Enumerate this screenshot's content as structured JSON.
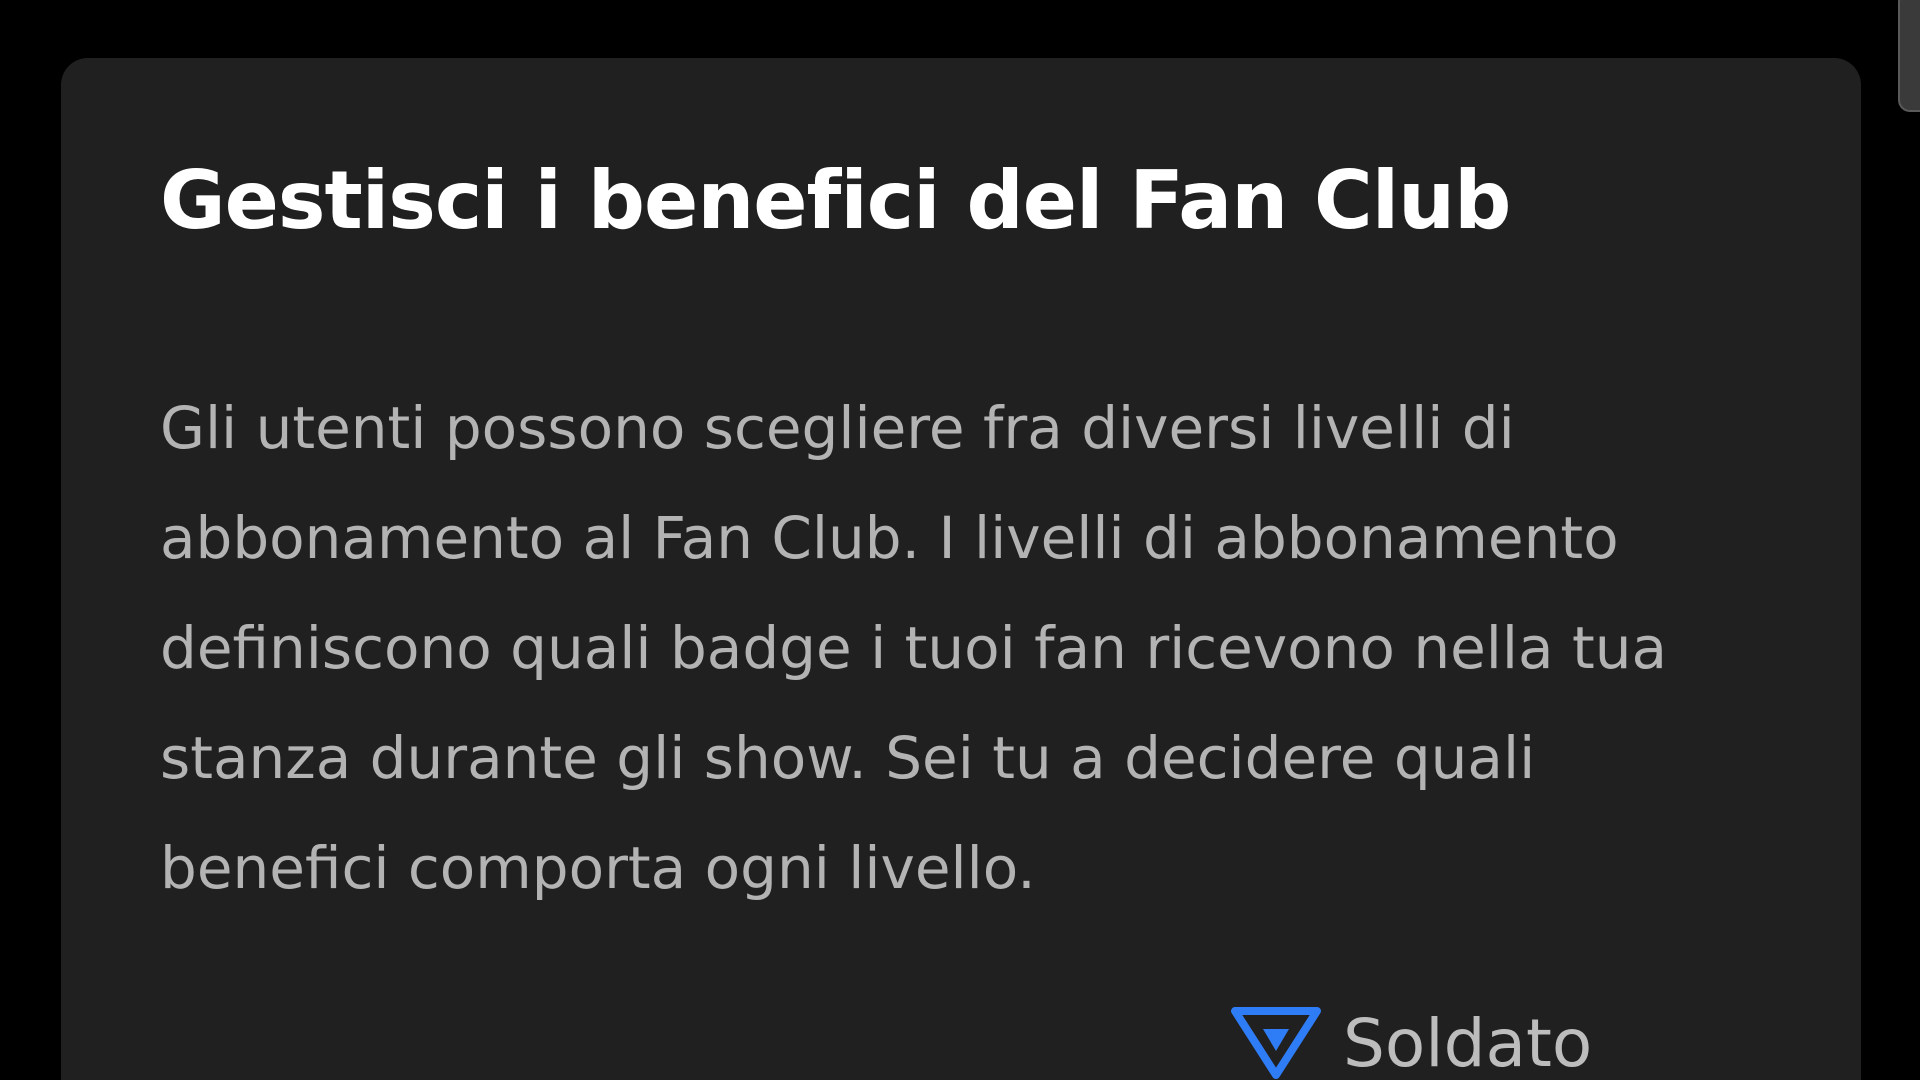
{
  "card": {
    "title": "Gestisci i benefici del Fan Club",
    "description": "Gli utenti possono scegliere fra diversi livelli di abbonamento al Fan Club. I livelli di abbonamento definiscono quali badge i tuoi fan ricevono nella tua stanza durante gli show. Sei tu a decidere quali benefici comporta ogni livello.",
    "tier": {
      "icon": "inverted-triangle-badge-icon",
      "icon_color": "#2e7cf6",
      "label": "Soldato"
    }
  },
  "colors": {
    "page_background": "#000000",
    "card_background": "#202020",
    "title": "#ffffff",
    "body_text": "#b3b3b3"
  }
}
